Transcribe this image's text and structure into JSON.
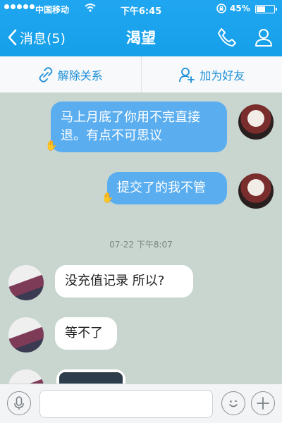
{
  "status": {
    "carrier": "中国移动",
    "time": "下午6:45",
    "battery": "45%",
    "battery_level": 0.45
  },
  "nav": {
    "back_label": "消息(5)",
    "title": "渴望"
  },
  "actions": {
    "unlink": "解除关系",
    "add_friend": "加为好友"
  },
  "messages": [
    {
      "side": "out",
      "text_line1": "马上月底了你用不完直接",
      "text_line2": "退。有点不可思议"
    },
    {
      "side": "out",
      "text": "提交了的我不管"
    },
    {
      "side": "in",
      "text": "没充值记录 所以?"
    },
    {
      "side": "in",
      "text": "等不了"
    }
  ],
  "timestamp": "07-22 下午8:07",
  "input": {
    "placeholder": ""
  },
  "icons": {
    "back": "chevron-left-icon",
    "phone": "phone-icon",
    "profile": "person-icon",
    "unlink": "broken-link-icon",
    "add_friend": "add-person-icon",
    "mic": "microphone-icon",
    "emoji": "emoji-icon",
    "plus": "plus-icon"
  },
  "colors": {
    "nav_bg": "#18a2ec",
    "accent": "#1e8fd8",
    "chat_bg": "#c8d6cf",
    "bubble_out": "#5aaef0"
  }
}
